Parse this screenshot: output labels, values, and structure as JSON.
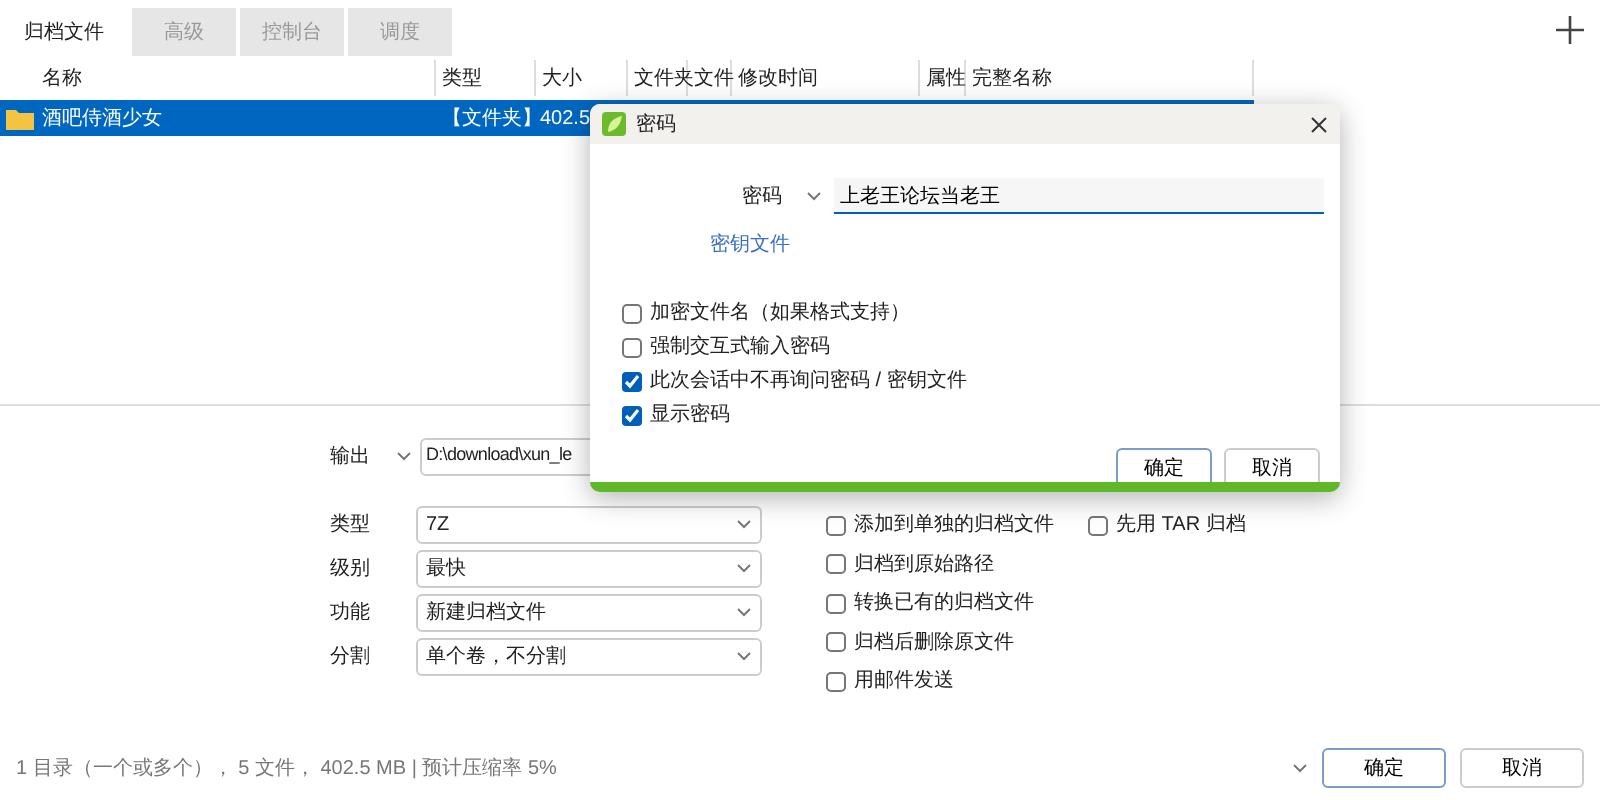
{
  "tabs": [
    {
      "label": "归档文件",
      "selected": true
    },
    {
      "label": "高级",
      "selected": false
    },
    {
      "label": "控制台",
      "selected": false
    },
    {
      "label": "调度",
      "selected": false
    }
  ],
  "file_list": {
    "columns": [
      "名称",
      "类型",
      "大小",
      "文件夹",
      "文件",
      "修改时间",
      "属性",
      "完整名称"
    ],
    "rows": [
      {
        "name": "酒吧侍酒少女",
        "type": "【文件夹】",
        "size": "402.5",
        "selected": true
      }
    ]
  },
  "options": {
    "output": {
      "label": "输出",
      "value": "D:\\download\\xun_le"
    },
    "selects": [
      {
        "label": "类型",
        "value": "7Z"
      },
      {
        "label": "级别",
        "value": "最快"
      },
      {
        "label": "功能",
        "value": "新建归档文件"
      },
      {
        "label": "分割",
        "value": "单个卷，不分割"
      }
    ],
    "checkboxes": [
      {
        "label": "添加到单独的归档文件",
        "checked": false
      },
      {
        "label": "归档到原始路径",
        "checked": false
      },
      {
        "label": "转换已有的归档文件",
        "checked": false
      },
      {
        "label": "归档后删除原文件",
        "checked": false
      },
      {
        "label": "用邮件发送",
        "checked": false
      }
    ],
    "side_checkbox": {
      "label": "先用 TAR 归档",
      "checked": false
    }
  },
  "status_bar": "1 目录（一个或多个）， 5 文件， 402.5 MB | 预计压缩率 5%",
  "buttons": [
    {
      "label": "确定",
      "default": true
    },
    {
      "label": "取消",
      "default": false
    }
  ],
  "dialog": {
    "title": "密码",
    "password_label": "密码",
    "password": "上老王论坛当老王",
    "keyfile_link": "密钥文件",
    "checkboxes": [
      {
        "label": "加密文件名（如果格式支持）",
        "checked": false
      },
      {
        "label": "强制交互式输入密码",
        "checked": false
      },
      {
        "label": "此次会话中不再询问密码 / 密钥文件",
        "checked": true
      },
      {
        "label": "显示密码",
        "checked": true
      }
    ],
    "buttons": [
      {
        "label": "确定",
        "default": true
      },
      {
        "label": "取消",
        "default": false
      }
    ]
  }
}
